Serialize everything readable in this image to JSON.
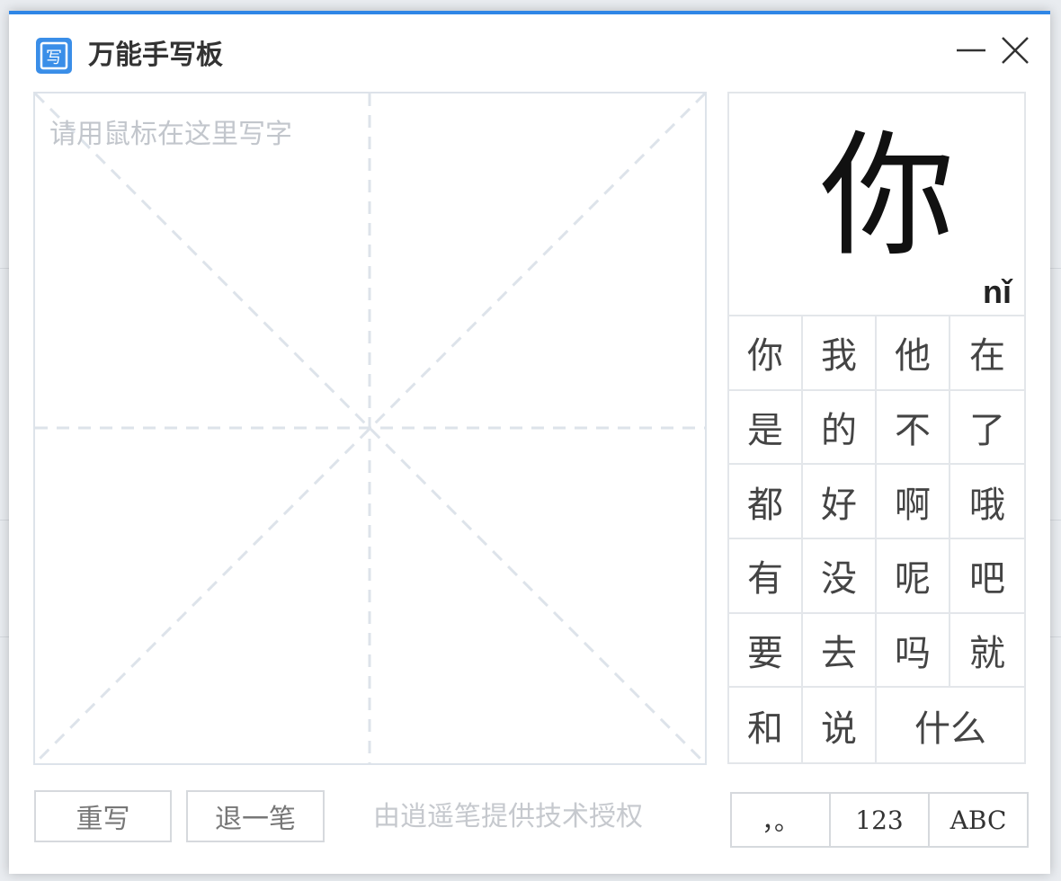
{
  "window": {
    "title": "万能手写板",
    "icon_glyph": "写"
  },
  "canvas": {
    "hint": "请用鼠标在这里写字"
  },
  "preview": {
    "char": "你",
    "pinyin": "nǐ"
  },
  "candidates": [
    "你",
    "我",
    "他",
    "在",
    "是",
    "的",
    "不",
    "了",
    "都",
    "好",
    "啊",
    "哦",
    "有",
    "没",
    "呢",
    "吧",
    "要",
    "去",
    "吗",
    "就",
    "和",
    "说",
    "什么"
  ],
  "buttons": {
    "rewrite": "重写",
    "undo": "退一笔"
  },
  "credit": "由逍遥笔提供技术授权",
  "modes": [
    "，。",
    "123",
    "ABC"
  ],
  "colors": {
    "accent": "#2f86e6",
    "grid_line": "#dde3ea"
  }
}
